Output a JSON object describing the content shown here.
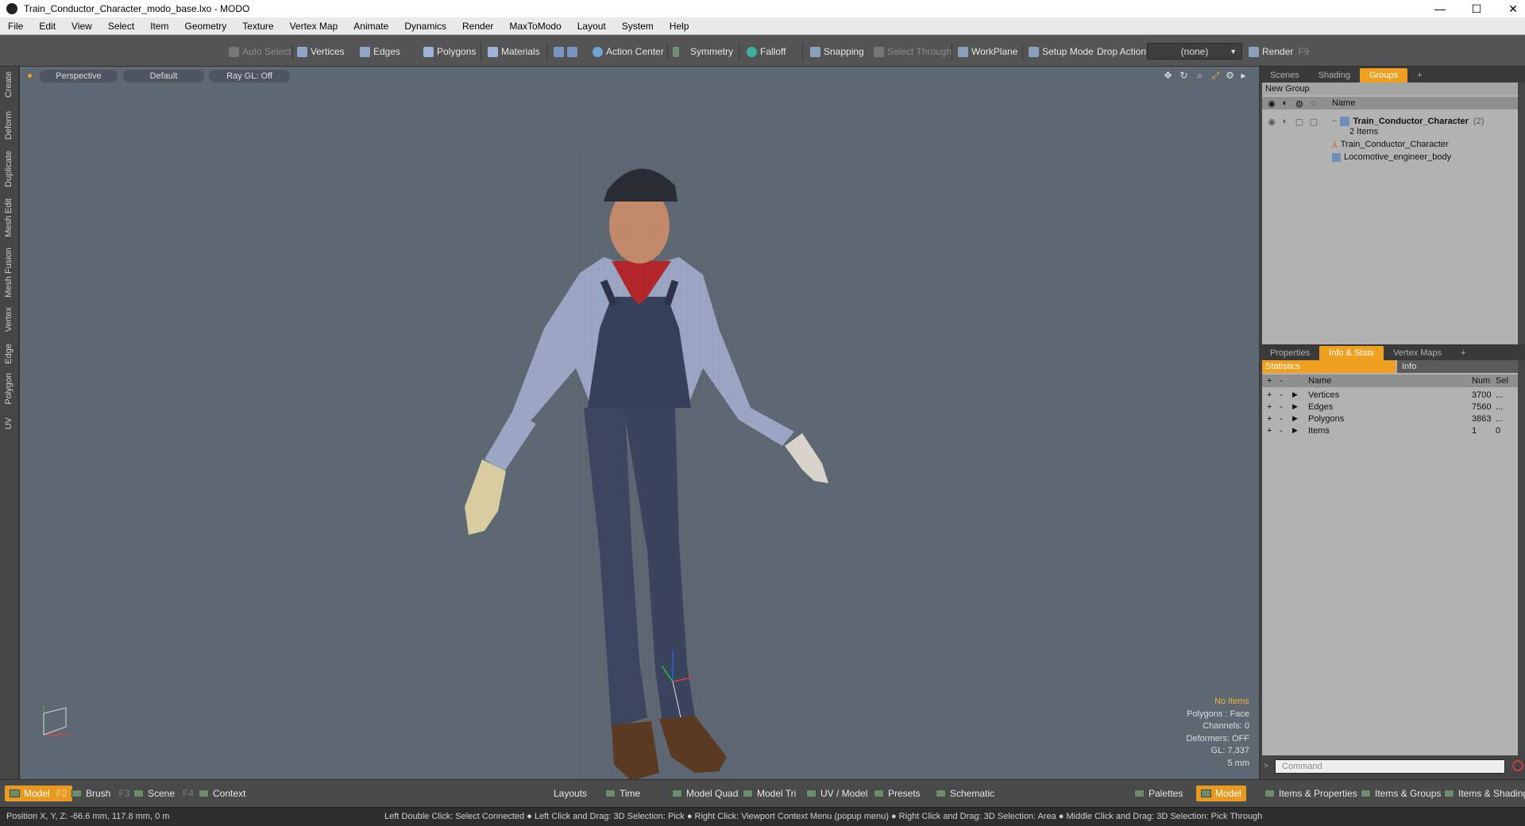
{
  "window": {
    "title": "Train_Conductor_Character_modo_base.lxo - MODO"
  },
  "menu": [
    "File",
    "Edit",
    "View",
    "Select",
    "Item",
    "Geometry",
    "Texture",
    "Vertex Map",
    "Animate",
    "Dynamics",
    "Render",
    "MaxToModo",
    "Layout",
    "System",
    "Help"
  ],
  "toolbar": {
    "auto_select": "Auto Select",
    "vertices": "Vertices",
    "edges": "Edges",
    "polygons": "Polygons",
    "materials": "Materials",
    "action_center": "Action Center",
    "symmetry": "Symmetry",
    "falloff": "Falloff",
    "snapping": "Snapping",
    "select_through": "Select Through",
    "workplane": "WorkPlane",
    "setup_mode": "Setup Mode",
    "drop_action": "Drop Action",
    "drop_value": "(none)",
    "render": "Render",
    "render_key": "F9"
  },
  "left_tabs": [
    "Create",
    "Deform",
    "Duplicate",
    "Mesh Edit",
    "Mesh Fusion",
    "Vertex",
    "Edge",
    "Polygon",
    "UV"
  ],
  "viewport": {
    "view": "Perspective",
    "shading": "Default",
    "raygl": "Ray GL: Off",
    "info": {
      "items": "No Items",
      "polygons": "Polygons : Face",
      "channels": "Channels: 0",
      "deformers": "Deformers: OFF",
      "gl": "GL: 7,337",
      "scale": "5 mm"
    }
  },
  "scene_panel": {
    "tabs": [
      "Scenes",
      "Shading",
      "Groups"
    ],
    "active_tab": "Groups",
    "new_group": "New Group",
    "name_header": "Name",
    "root": {
      "name": "Train_Conductor_Character",
      "count": "(2)",
      "sub": "2 Items"
    },
    "children": [
      "Train_Conductor_Character",
      "Locomotive_engineer_body"
    ]
  },
  "info_panel": {
    "tabs": [
      "Properties",
      "Info & Stats",
      "Vertex Maps"
    ],
    "active_tab": "Info & Stats",
    "subtabs": [
      "Statistics",
      "Info"
    ],
    "headers": {
      "name": "Name",
      "num": "Num",
      "sel": "Sel"
    },
    "rows": [
      {
        "name": "Vertices",
        "num": "3700",
        "sel": "..."
      },
      {
        "name": "Edges",
        "num": "7560",
        "sel": "..."
      },
      {
        "name": "Polygons",
        "num": "3863",
        "sel": "..."
      },
      {
        "name": "Items",
        "num": "1",
        "sel": "0"
      }
    ]
  },
  "command": {
    "placeholder": "Command"
  },
  "bottom": {
    "model": "Model",
    "model_key": "F2",
    "brush": "Brush",
    "brush_key": "F3",
    "scene": "Scene",
    "scene_key": "F4",
    "context": "Context",
    "layouts": "Layouts",
    "time": "Time",
    "model_quad": "Model Quad",
    "model_tri": "Model Tri",
    "uv_model": "UV / Model",
    "presets": "Presets",
    "schematic": "Schematic",
    "palettes": "Palettes",
    "model_right": "Model",
    "items_props": "Items & Properties",
    "items_groups": "Items & Groups",
    "items_shading": "Items & Shading"
  },
  "status": {
    "position": "Position X, Y, Z:   -66.6 mm, 117.8 mm, 0 m",
    "hints": "Left Double Click: Select Connected ● Left Click and Drag: 3D Selection: Pick ● Right Click: Viewport Context Menu (popup menu) ● Right Click and Drag: 3D Selection: Area ● Middle Click and Drag: 3D Selection: Pick Through"
  },
  "colors": {
    "accent": "#f0a020",
    "viewport_bg": "#5e6872",
    "panel_bg": "#b2b2b2"
  }
}
